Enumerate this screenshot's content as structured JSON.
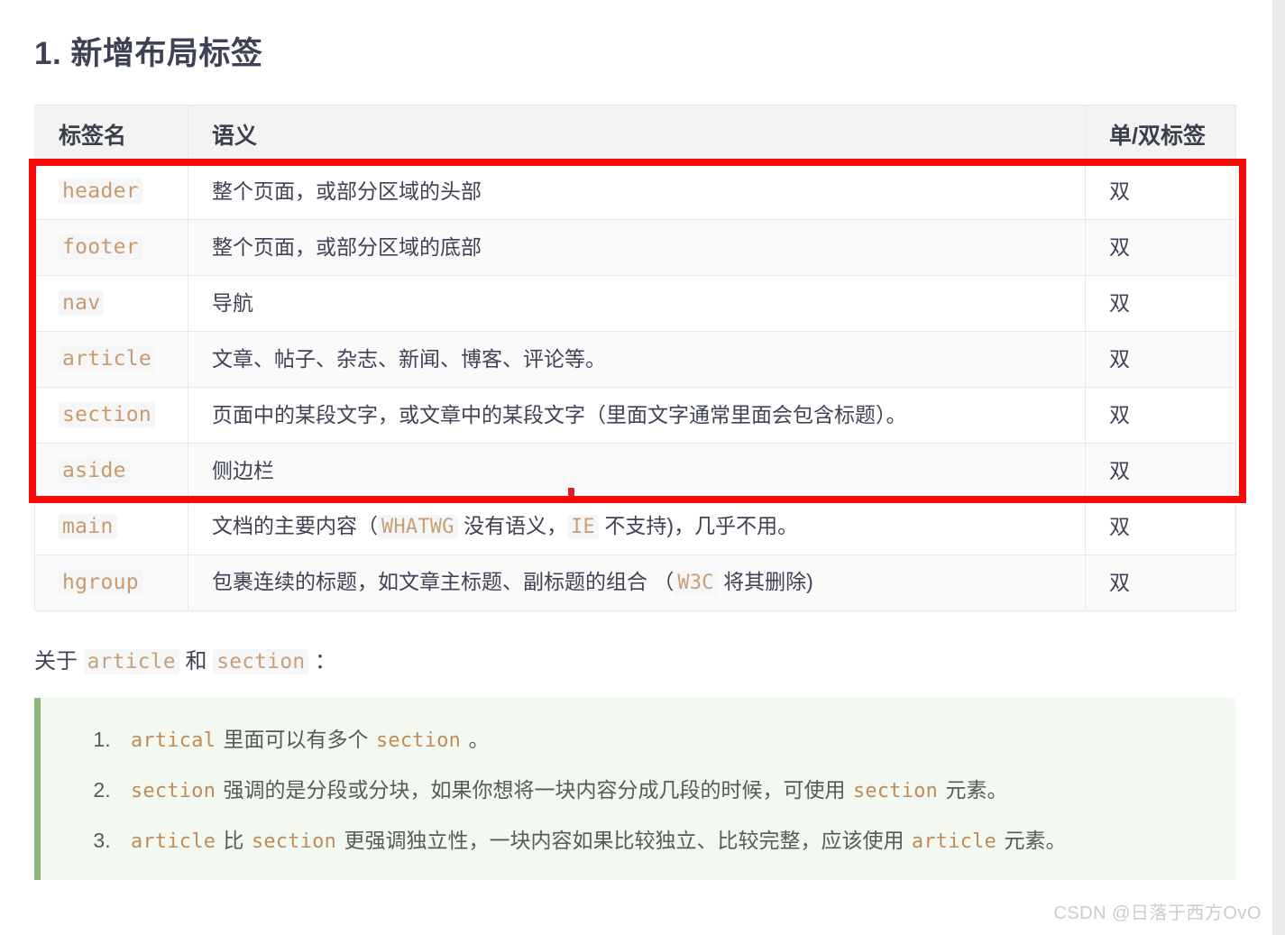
{
  "heading": "1. 新增布局标签",
  "table": {
    "columns": [
      "标签名",
      "语义",
      "单/双标签"
    ],
    "rows": [
      {
        "tag": "header",
        "semantic_parts": [
          {
            "t": "text",
            "v": "整个页面，或部分区域的头部"
          }
        ],
        "type": "双",
        "highlighted": true
      },
      {
        "tag": "footer",
        "semantic_parts": [
          {
            "t": "text",
            "v": "整个页面，或部分区域的底部"
          }
        ],
        "type": "双",
        "highlighted": true
      },
      {
        "tag": "nav",
        "semantic_parts": [
          {
            "t": "text",
            "v": "导航"
          }
        ],
        "type": "双",
        "highlighted": true
      },
      {
        "tag": "article",
        "semantic_parts": [
          {
            "t": "text",
            "v": "文章、帖子、杂志、新闻、博客、评论等。"
          }
        ],
        "type": "双",
        "highlighted": true
      },
      {
        "tag": "section",
        "semantic_parts": [
          {
            "t": "text",
            "v": "页面中的某段文字，或文章中的某段文字（里面文字通常里面会包含标题）。"
          }
        ],
        "type": "双",
        "highlighted": true
      },
      {
        "tag": "aside",
        "semantic_parts": [
          {
            "t": "text",
            "v": "侧边栏"
          }
        ],
        "type": "双",
        "highlighted": true
      },
      {
        "tag": "main",
        "semantic_parts": [
          {
            "t": "text",
            "v": "文档的主要内容（"
          },
          {
            "t": "code",
            "v": "WHATWG"
          },
          {
            "t": "text",
            "v": " 没有语义，"
          },
          {
            "t": "code",
            "v": "IE"
          },
          {
            "t": "text",
            "v": " 不支持)，几乎不用。"
          }
        ],
        "type": "双",
        "highlighted": false
      },
      {
        "tag": "hgroup",
        "semantic_parts": [
          {
            "t": "text",
            "v": "包裹连续的标题，如文章主标题、副标题的组合 （"
          },
          {
            "t": "code",
            "v": "W3C"
          },
          {
            "t": "text",
            "v": " 将其删除)"
          }
        ],
        "type": "双",
        "highlighted": false
      }
    ]
  },
  "about_line": {
    "parts": [
      {
        "t": "text",
        "v": "关于 "
      },
      {
        "t": "code",
        "v": "article"
      },
      {
        "t": "text",
        "v": " 和 "
      },
      {
        "t": "code",
        "v": "section"
      },
      {
        "t": "text",
        "v": " ："
      }
    ]
  },
  "note": {
    "items": [
      {
        "index": "1.",
        "parts": [
          {
            "t": "code",
            "v": "artical"
          },
          {
            "t": "text",
            "v": " 里面可以有多个 "
          },
          {
            "t": "code",
            "v": "section"
          },
          {
            "t": "text",
            "v": " 。"
          }
        ]
      },
      {
        "index": "2.",
        "parts": [
          {
            "t": "code",
            "v": "section"
          },
          {
            "t": "text",
            "v": " 强调的是分段或分块，如果你想将一块内容分成几段的时候，可使用 "
          },
          {
            "t": "code",
            "v": "section"
          },
          {
            "t": "text",
            "v": " 元素。"
          }
        ]
      },
      {
        "index": "3.",
        "parts": [
          {
            "t": "code",
            "v": "article"
          },
          {
            "t": "text",
            "v": " 比 "
          },
          {
            "t": "code",
            "v": "section"
          },
          {
            "t": "text",
            "v": " 更强调独立性，一块内容如果比较独立、比较完整，应该使用 "
          },
          {
            "t": "code",
            "v": "article"
          },
          {
            "t": "text",
            "v": " 元素。"
          }
        ]
      }
    ]
  },
  "watermark": "CSDN @日落于西方OvO",
  "colors": {
    "annotation_red": "#fa0707",
    "note_accent_green": "#8cba7d",
    "note_background": "#f3f9f1",
    "code_text": "#c89a6e",
    "body_text": "#3f4254",
    "table_header_bg": "#f3f3f3"
  }
}
